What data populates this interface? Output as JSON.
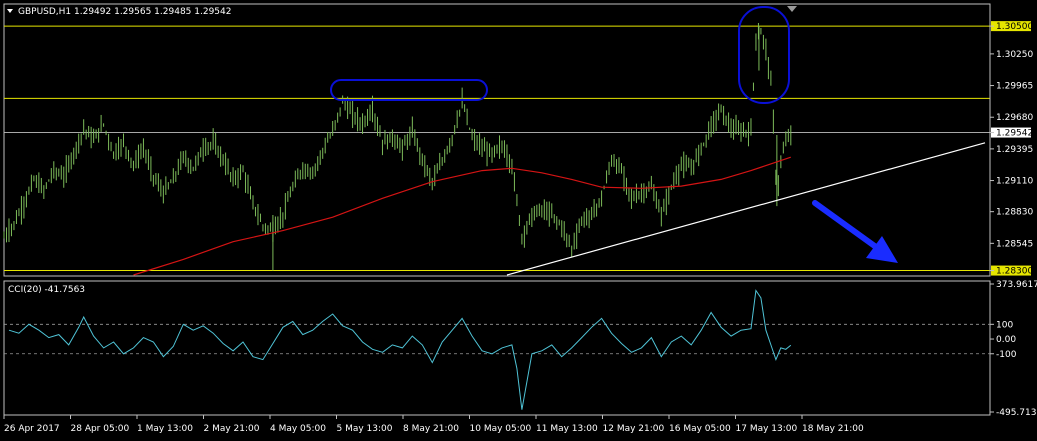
{
  "main_header": "GBPUSD,H1  1.29492 1.29565 1.29485 1.29542",
  "cci_header": "CCI(20) -41.7563",
  "colors": {
    "background": "#000000",
    "candles": "#7dbb5a",
    "moving_average": "#d41414",
    "cci": "#4fc3d6",
    "level_lines": "#e6e600",
    "highlight_box": "#0a10d6",
    "trend_arrow": "#1a2cff",
    "axis": "#c0c0c0"
  },
  "chart_data": [
    {
      "type": "line",
      "symbol": "GBPUSD",
      "timeframe": "H1",
      "ylim": [
        1.2826,
        1.3069
      ],
      "price_ticks": [
        "1.30500",
        "1.30250",
        "1.29965",
        "1.29680",
        "1.29542",
        "1.29395",
        "1.29110",
        "1.28830",
        "1.28545",
        "1.28300"
      ],
      "highlighted_prices": [
        "1.30500",
        "1.29850",
        "1.28300"
      ],
      "current_price": "1.29542",
      "date_labels": [
        "26 Apr 2017",
        "28 Apr 05:00",
        "1 May 13:00",
        "2 May 21:00",
        "4 May 05:00",
        "5 May 13:00",
        "8 May 21:00",
        "10 May 05:00",
        "11 May 13:00",
        "12 May 21:00",
        "16 May 05:00",
        "17 May 13:00",
        "18 May 21:00"
      ],
      "price_path": [
        [
          0,
          1.286
        ],
        [
          10,
          1.2872
        ],
        [
          20,
          1.289
        ],
        [
          30,
          1.2912
        ],
        [
          40,
          1.2902
        ],
        [
          50,
          1.292
        ],
        [
          60,
          1.2915
        ],
        [
          70,
          1.2935
        ],
        [
          80,
          1.2958
        ],
        [
          90,
          1.2948
        ],
        [
          100,
          1.2962
        ],
        [
          110,
          1.2935
        ],
        [
          120,
          1.2945
        ],
        [
          130,
          1.2925
        ],
        [
          140,
          1.294
        ],
        [
          150,
          1.2915
        ],
        [
          160,
          1.29
        ],
        [
          170,
          1.2912
        ],
        [
          180,
          1.2932
        ],
        [
          190,
          1.2922
        ],
        [
          200,
          1.294
        ],
        [
          210,
          1.2945
        ],
        [
          220,
          1.293
        ],
        [
          230,
          1.2912
        ],
        [
          240,
          1.292
        ],
        [
          250,
          1.289
        ],
        [
          260,
          1.287
        ],
        [
          270,
          1.2866
        ],
        [
          280,
          1.288
        ],
        [
          290,
          1.2905
        ],
        [
          300,
          1.2922
        ],
        [
          310,
          1.2918
        ],
        [
          320,
          1.2938
        ],
        [
          330,
          1.2955
        ],
        [
          340,
          1.2982
        ],
        [
          350,
          1.297
        ],
        [
          360,
          1.2962
        ],
        [
          370,
          1.2975
        ],
        [
          380,
          1.2945
        ],
        [
          390,
          1.295
        ],
        [
          400,
          1.294
        ],
        [
          410,
          1.2955
        ],
        [
          420,
          1.293
        ],
        [
          430,
          1.291
        ],
        [
          440,
          1.2928
        ],
        [
          450,
          1.295
        ],
        [
          460,
          1.2982
        ],
        [
          470,
          1.295
        ],
        [
          480,
          1.294
        ],
        [
          490,
          1.2935
        ],
        [
          500,
          1.2942
        ],
        [
          510,
          1.2925
        ],
        [
          520,
          1.286
        ],
        [
          530,
          1.288
        ],
        [
          540,
          1.2885
        ],
        [
          550,
          1.288
        ],
        [
          560,
          1.287
        ],
        [
          570,
          1.285
        ],
        [
          580,
          1.2875
        ],
        [
          590,
          1.288
        ],
        [
          600,
          1.2895
        ],
        [
          610,
          1.293
        ],
        [
          620,
          1.292
        ],
        [
          630,
          1.2895
        ],
        [
          640,
          1.29
        ],
        [
          650,
          1.2905
        ],
        [
          660,
          1.288
        ],
        [
          670,
          1.2905
        ],
        [
          680,
          1.2925
        ],
        [
          690,
          1.2922
        ],
        [
          700,
          1.294
        ],
        [
          710,
          1.296
        ],
        [
          720,
          1.2975
        ],
        [
          730,
          1.2958
        ],
        [
          740,
          1.2955
        ],
        [
          750,
          1.2955
        ],
        [
          755,
          1.304
        ],
        [
          760,
          1.3045
        ],
        [
          765,
          1.303
        ],
        [
          770,
          1.3
        ],
        [
          774,
          1.294
        ],
        [
          776,
          1.2892
        ],
        [
          780,
          1.293
        ],
        [
          785,
          1.2945
        ],
        [
          790,
          1.2954
        ]
      ],
      "ma_path": [
        [
          130,
          1.2826
        ],
        [
          180,
          1.284
        ],
        [
          230,
          1.2856
        ],
        [
          280,
          1.2866
        ],
        [
          330,
          1.2878
        ],
        [
          380,
          1.2895
        ],
        [
          430,
          1.291
        ],
        [
          480,
          1.292
        ],
        [
          510,
          1.2922
        ],
        [
          540,
          1.2918
        ],
        [
          570,
          1.2912
        ],
        [
          600,
          1.2905
        ],
        [
          640,
          1.2904
        ],
        [
          680,
          1.2906
        ],
        [
          720,
          1.2912
        ],
        [
          750,
          1.292
        ],
        [
          790,
          1.2932
        ]
      ],
      "trendline": [
        [
          505,
          1.2826
        ],
        [
          985,
          1.2945
        ]
      ]
    },
    {
      "type": "line",
      "name": "CCI(20)",
      "ylim": [
        -495.7138,
        373.9617
      ],
      "level_ticks": [
        "373.9617",
        "100",
        "0.00",
        "-100",
        "-495.7138"
      ],
      "values": [
        [
          5,
          60
        ],
        [
          15,
          40
        ],
        [
          25,
          100
        ],
        [
          35,
          60
        ],
        [
          45,
          10
        ],
        [
          55,
          30
        ],
        [
          65,
          -40
        ],
        [
          75,
          80
        ],
        [
          80,
          150
        ],
        [
          90,
          20
        ],
        [
          100,
          -60
        ],
        [
          110,
          -20
        ],
        [
          120,
          -100
        ],
        [
          130,
          -60
        ],
        [
          140,
          10
        ],
        [
          150,
          -20
        ],
        [
          160,
          -120
        ],
        [
          170,
          -50
        ],
        [
          180,
          100
        ],
        [
          190,
          60
        ],
        [
          200,
          90
        ],
        [
          210,
          40
        ],
        [
          220,
          -30
        ],
        [
          230,
          -80
        ],
        [
          240,
          -20
        ],
        [
          250,
          -120
        ],
        [
          260,
          -140
        ],
        [
          270,
          -30
        ],
        [
          280,
          80
        ],
        [
          290,
          120
        ],
        [
          300,
          30
        ],
        [
          310,
          60
        ],
        [
          320,
          120
        ],
        [
          330,
          170
        ],
        [
          340,
          90
        ],
        [
          350,
          60
        ],
        [
          360,
          -20
        ],
        [
          370,
          -70
        ],
        [
          380,
          -90
        ],
        [
          390,
          -40
        ],
        [
          400,
          -60
        ],
        [
          410,
          20
        ],
        [
          420,
          -40
        ],
        [
          430,
          -160
        ],
        [
          440,
          -20
        ],
        [
          450,
          60
        ],
        [
          460,
          140
        ],
        [
          470,
          20
        ],
        [
          480,
          -80
        ],
        [
          490,
          -100
        ],
        [
          500,
          -60
        ],
        [
          510,
          -40
        ],
        [
          515,
          -200
        ],
        [
          520,
          -480
        ],
        [
          530,
          -100
        ],
        [
          540,
          -80
        ],
        [
          550,
          -40
        ],
        [
          560,
          -120
        ],
        [
          570,
          -60
        ],
        [
          580,
          10
        ],
        [
          590,
          80
        ],
        [
          600,
          140
        ],
        [
          610,
          40
        ],
        [
          620,
          -30
        ],
        [
          630,
          -90
        ],
        [
          640,
          -60
        ],
        [
          650,
          10
        ],
        [
          660,
          -120
        ],
        [
          670,
          -20
        ],
        [
          680,
          20
        ],
        [
          690,
          -40
        ],
        [
          700,
          60
        ],
        [
          710,
          180
        ],
        [
          720,
          80
        ],
        [
          730,
          20
        ],
        [
          740,
          60
        ],
        [
          750,
          70
        ],
        [
          755,
          330
        ],
        [
          760,
          280
        ],
        [
          765,
          60
        ],
        [
          770,
          -40
        ],
        [
          775,
          -140
        ],
        [
          780,
          -60
        ],
        [
          785,
          -70
        ],
        [
          790,
          -41.7563
        ]
      ]
    }
  ]
}
